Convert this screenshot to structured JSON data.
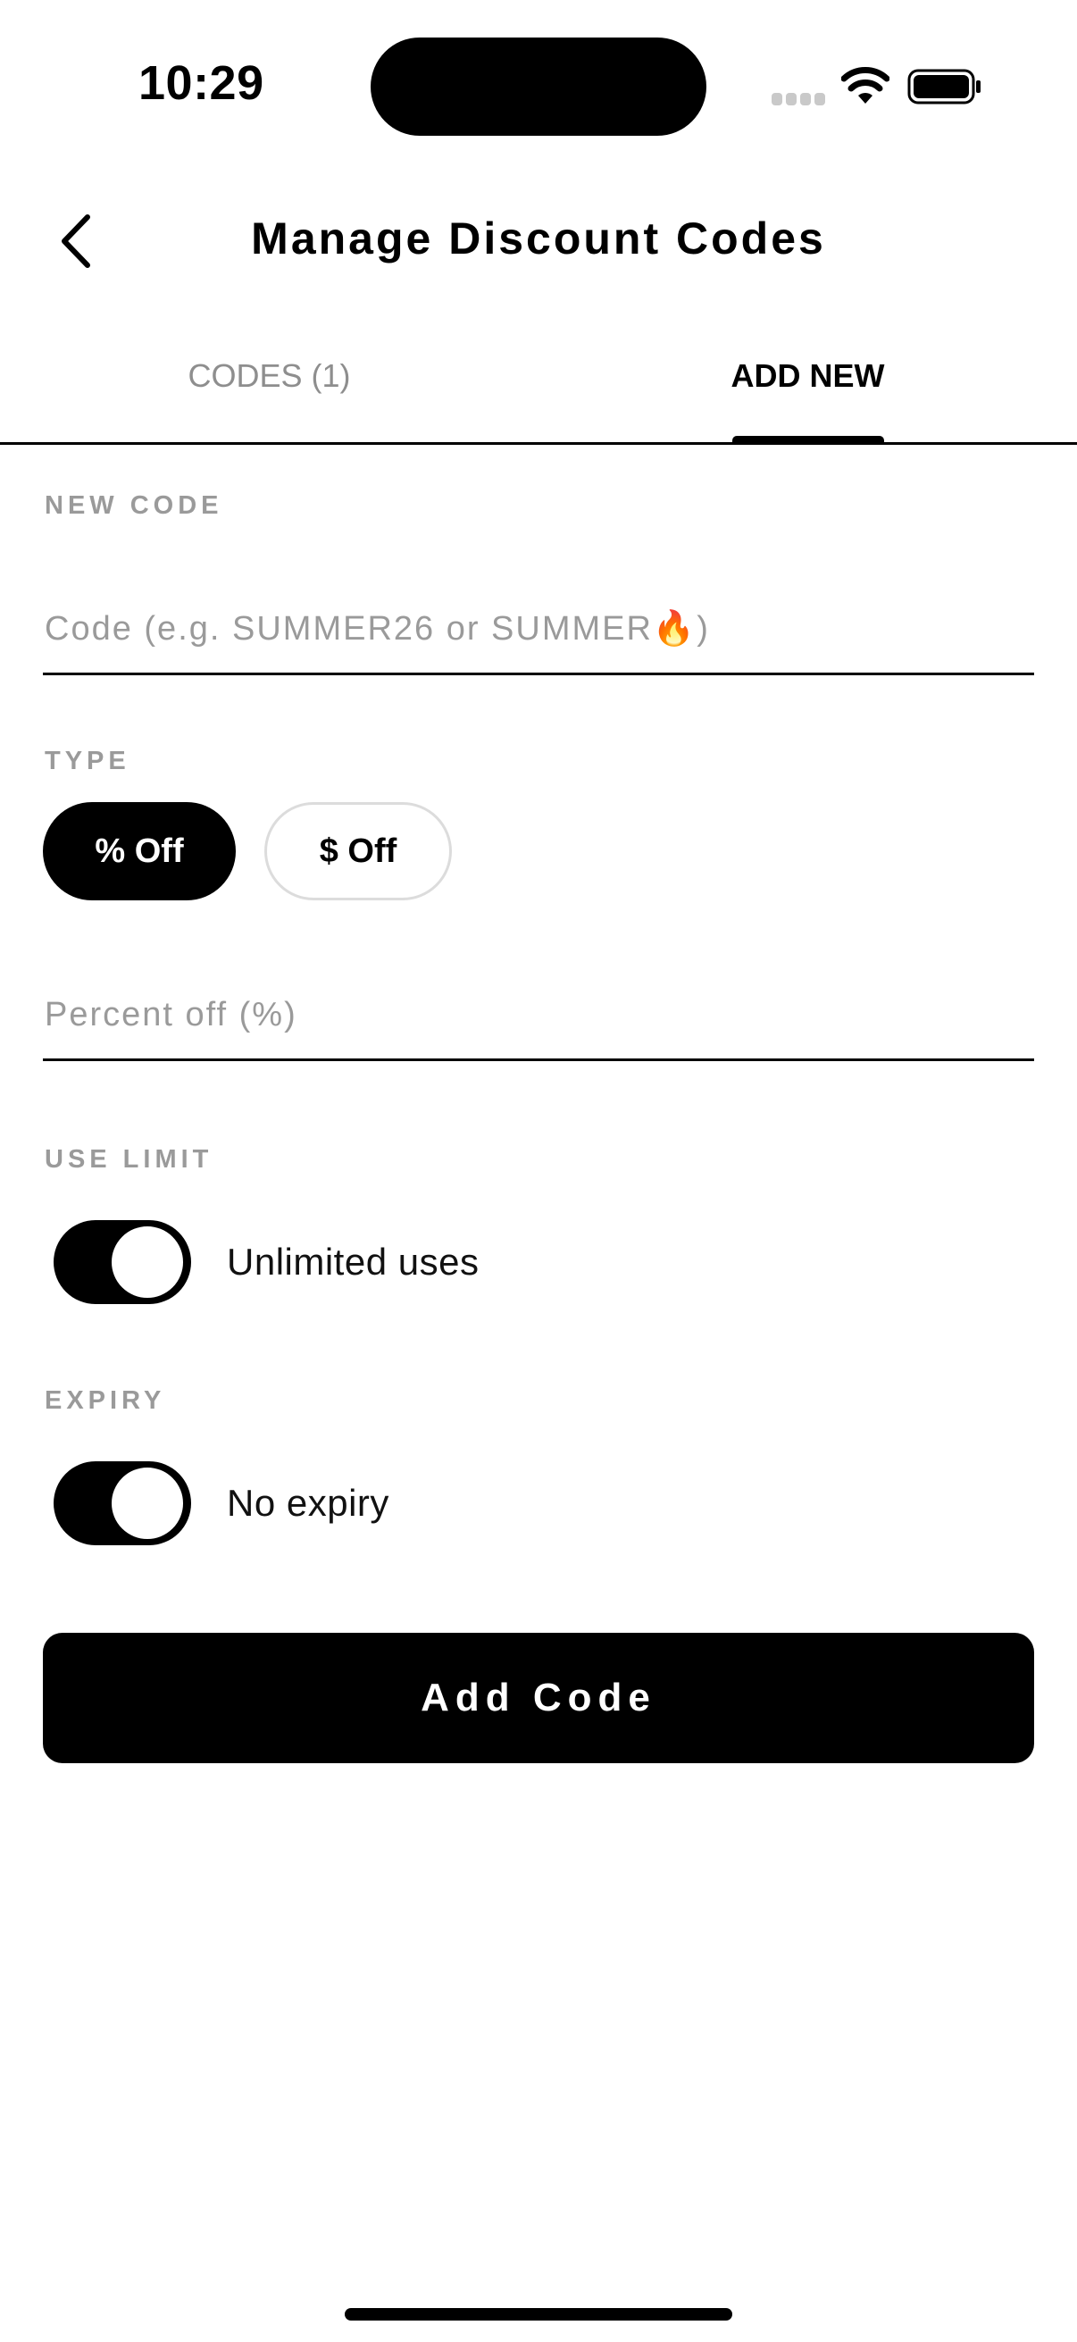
{
  "status_bar": {
    "time": "10:29"
  },
  "header": {
    "title": "Manage Discount Codes"
  },
  "tabs": [
    {
      "label": "CODES (1)",
      "active": false
    },
    {
      "label": "ADD NEW",
      "active": true
    }
  ],
  "form": {
    "new_code": {
      "label": "NEW CODE",
      "placeholder": "Code (e.g. SUMMER26 or SUMMER🔥)",
      "value": ""
    },
    "type": {
      "label": "TYPE",
      "options": [
        "% Off",
        "$ Off"
      ],
      "selected": "% Off"
    },
    "percent": {
      "placeholder": "Percent off (%)",
      "value": ""
    },
    "use_limit": {
      "label": "USE LIMIT",
      "toggle_label": "Unlimited uses",
      "enabled": true
    },
    "expiry": {
      "label": "EXPIRY",
      "toggle_label": "No expiry",
      "enabled": true
    },
    "submit_label": "Add Code"
  },
  "colors": {
    "primary": "#000000",
    "background": "#ffffff",
    "muted_text": "#9a9a9a",
    "pill_border": "#dcdcdc"
  }
}
